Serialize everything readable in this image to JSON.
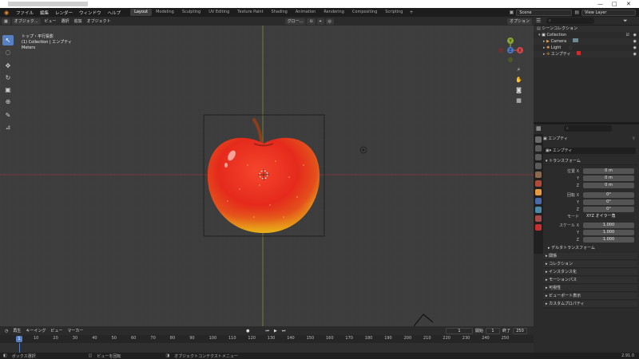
{
  "topbar": {
    "menus": [
      "ファイル",
      "編集",
      "レンダー",
      "ウィンドウ",
      "ヘルプ"
    ],
    "workspaces": [
      "Layout",
      "Modeling",
      "Sculpting",
      "UV Editing",
      "Texture Paint",
      "Shading",
      "Animation",
      "Rendering",
      "Compositing",
      "Scripting"
    ],
    "active_workspace": "Layout",
    "add": "+",
    "scene": "Scene",
    "view_layer": "View Layer"
  },
  "viewport_header": {
    "mode": "オブジェク...",
    "menus": [
      "ビュー",
      "選択",
      "追加",
      "オブジェクト"
    ],
    "transform": "グロー...",
    "options": "オプション"
  },
  "overlay": {
    "view": "トップ・平行投影",
    "collection": "(1) Collection | エンプティ",
    "units": "Meters"
  },
  "gizmo": {
    "y": "Y",
    "x": "X",
    "z": "Z"
  },
  "outliner": {
    "title": "シーンコレクション",
    "items": [
      "Collection",
      "Camera",
      "Light",
      "エンプティ"
    ]
  },
  "properties": {
    "object_name": "エンプティ",
    "data_name": "エンプティ",
    "transform_title": "トランスフォーム",
    "location_label": "位置 X",
    "rotation_label": "回転 X",
    "scale_label": "スケール X",
    "axis_y": "Y",
    "axis_z": "Z",
    "loc": [
      "0 m",
      "0 m",
      "0 m"
    ],
    "rot": [
      "0°",
      "0°",
      "0°"
    ],
    "mode_label": "モード",
    "mode_value": "XYZ オイラー角",
    "scale": [
      "1.000",
      "1.000",
      "1.000"
    ],
    "panels": [
      "デルタトランスフォーム",
      "関係",
      "コレクション",
      "インスタンス化",
      "モーションパス",
      "可視性",
      "ビューポート表示",
      "カスタムプロパティ"
    ]
  },
  "timeline": {
    "menus": [
      "再生",
      "キーイング",
      "ビュー",
      "マーカー"
    ],
    "current_frame": "1",
    "start_label": "開始",
    "start": "1",
    "end_label": "終了",
    "end": "250",
    "ticks": [
      "10",
      "20",
      "30",
      "40",
      "50",
      "60",
      "70",
      "80",
      "90",
      "100",
      "110",
      "120",
      "130",
      "140",
      "150",
      "160",
      "170",
      "180",
      "190",
      "200",
      "210",
      "220",
      "230",
      "240",
      "250"
    ],
    "playhead": "1"
  },
  "status": {
    "box_select": "ボックス選択",
    "rotate_view": "ビューを回転",
    "context_menu": "オブジェクトコンテクストメニュー",
    "version": "2.91.0"
  },
  "colors": {
    "accent": "#5680c2",
    "apple_red": "#e52a1c",
    "apple_yellow": "#e8b318",
    "xaxis": "#a33a3a",
    "yaxis": "#8a9a2a"
  }
}
